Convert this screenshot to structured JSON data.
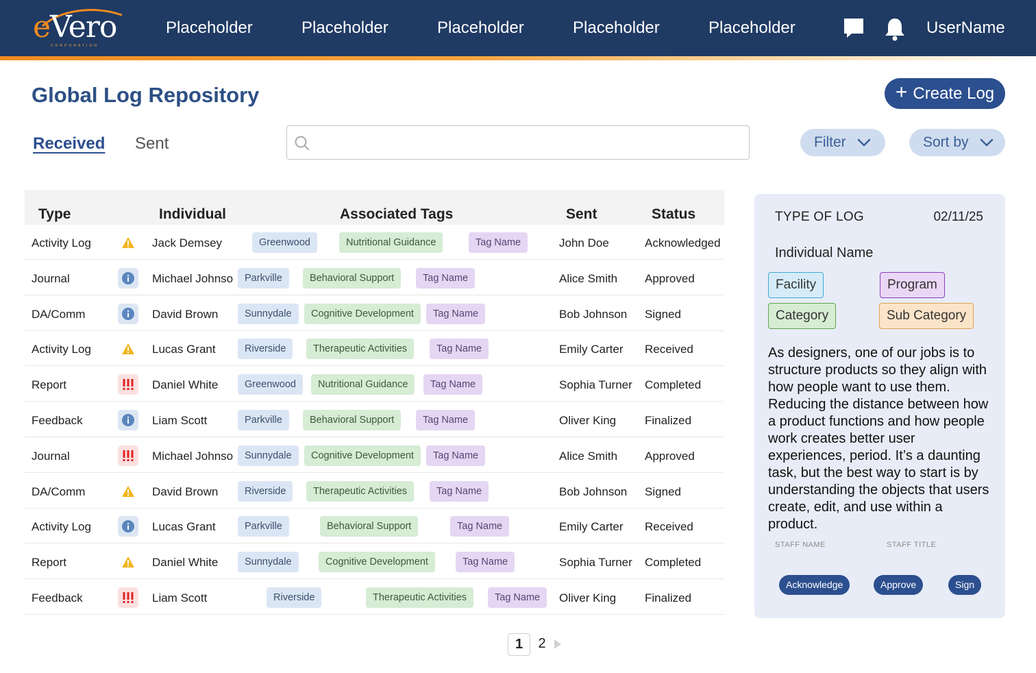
{
  "header": {
    "logo_text_e": "e",
    "logo_text_rest": "Vero",
    "logo_sub": "CORPORATION",
    "nav": [
      "Placeholder",
      "Placeholder",
      "Placeholder",
      "Placeholder",
      "Placeholder"
    ],
    "username": "UserName",
    "icons": [
      "chat-icon",
      "bell-icon"
    ]
  },
  "page": {
    "title": "Global Log Repository",
    "create_label": "Create Log"
  },
  "tabs": [
    {
      "label": "Received",
      "active": true
    },
    {
      "label": "Sent",
      "active": false
    }
  ],
  "search": {
    "placeholder": ""
  },
  "controls": {
    "filter_label": "Filter",
    "sort_label": "Sort by"
  },
  "table": {
    "headers": {
      "type": "Type",
      "individual": "Individual",
      "tags": "Associated Tags",
      "sent": "Sent",
      "status": "Status"
    },
    "rows": [
      {
        "type": "Activity Log",
        "icon": "warning",
        "individual": "Jack Demsey",
        "location": "Greenwood",
        "topic": "Nutritional Guidance",
        "tag": "Tag Name",
        "sent": "John Doe",
        "status": "Acknowledged"
      },
      {
        "type": "Journal",
        "icon": "info",
        "individual": "Michael Johnson",
        "location": "Parkville",
        "topic": "Behavioral Support",
        "tag": "Tag Name",
        "sent": "Alice Smith",
        "status": "Approved"
      },
      {
        "type": "DA/Comm",
        "icon": "info",
        "individual": "David Brown",
        "location": "Sunnydale",
        "topic": "Cognitive Development",
        "tag": "Tag Name",
        "sent": "Bob Johnson",
        "status": "Signed"
      },
      {
        "type": "Activity Log",
        "icon": "warning",
        "individual": "Lucas Grant",
        "location": "Riverside",
        "topic": "Therapeutic Activities",
        "tag": "Tag Name",
        "sent": "Emily Carter",
        "status": "Received"
      },
      {
        "type": "Report",
        "icon": "alert",
        "individual": "Daniel White",
        "location": "Greenwood",
        "topic": "Nutritional Guidance",
        "tag": "Tag Name",
        "sent": "Sophia Turner",
        "status": "Completed"
      },
      {
        "type": "Feedback",
        "icon": "info",
        "individual": "Liam Scott",
        "location": "Parkville",
        "topic": "Behavioral Support",
        "tag": "Tag Name",
        "sent": "Oliver King",
        "status": "Finalized"
      },
      {
        "type": "Journal",
        "icon": "alert",
        "individual": "Michael Johnson",
        "location": "Sunnydale",
        "topic": "Cognitive Development",
        "tag": "Tag Name",
        "sent": "Alice Smith",
        "status": "Approved"
      },
      {
        "type": "DA/Comm",
        "icon": "warning",
        "individual": "David Brown",
        "location": "Riverside",
        "topic": "Therapeutic Activities",
        "tag": "Tag Name",
        "sent": "Bob Johnson",
        "status": "Signed"
      },
      {
        "type": "Activity Log",
        "icon": "info",
        "individual": "Lucas Grant",
        "location": "Parkville",
        "topic": "Behavioral Support",
        "tag": "Tag Name",
        "sent": "Emily Carter",
        "status": "Received"
      },
      {
        "type": "Report",
        "icon": "warning",
        "individual": "Daniel White",
        "location": "Sunnydale",
        "topic": "Cognitive Development",
        "tag": "Tag Name",
        "sent": "Sophia Turner",
        "status": "Completed"
      },
      {
        "type": "Feedback",
        "icon": "alert",
        "individual": "Liam Scott",
        "location": "Riverside",
        "topic": "Therapeutic Activities",
        "tag": "Tag Name",
        "sent": "Oliver King",
        "status": "Finalized"
      }
    ]
  },
  "pagination": {
    "current": "1",
    "next_page": "2"
  },
  "detail": {
    "type_label": "TYPE OF LOG",
    "date": "02/11/25",
    "individual": "Individual Name",
    "tags": {
      "facility": "Facility",
      "program": "Program",
      "category": "Category",
      "sub_category": "Sub Category"
    },
    "body": "As designers, one of our jobs is to structure products so they align with how people want to use them. Reducing the distance between how a product functions and how people work creates better user experiences, period. It’s a daunting task, but the best way to start is by understanding the objects that users create, edit, and use within a product.",
    "staff_name_label": "STAFF NAME",
    "staff_title_label": "STAFF TITLE",
    "actions": {
      "acknowledge": "Acknowledge",
      "approve": "Approve",
      "sign": "Sign"
    }
  },
  "colors": {
    "header_bg": "#1f3a63",
    "accent": "#f08b1f",
    "primary": "#2c4f8f",
    "title": "#2c4f85"
  }
}
